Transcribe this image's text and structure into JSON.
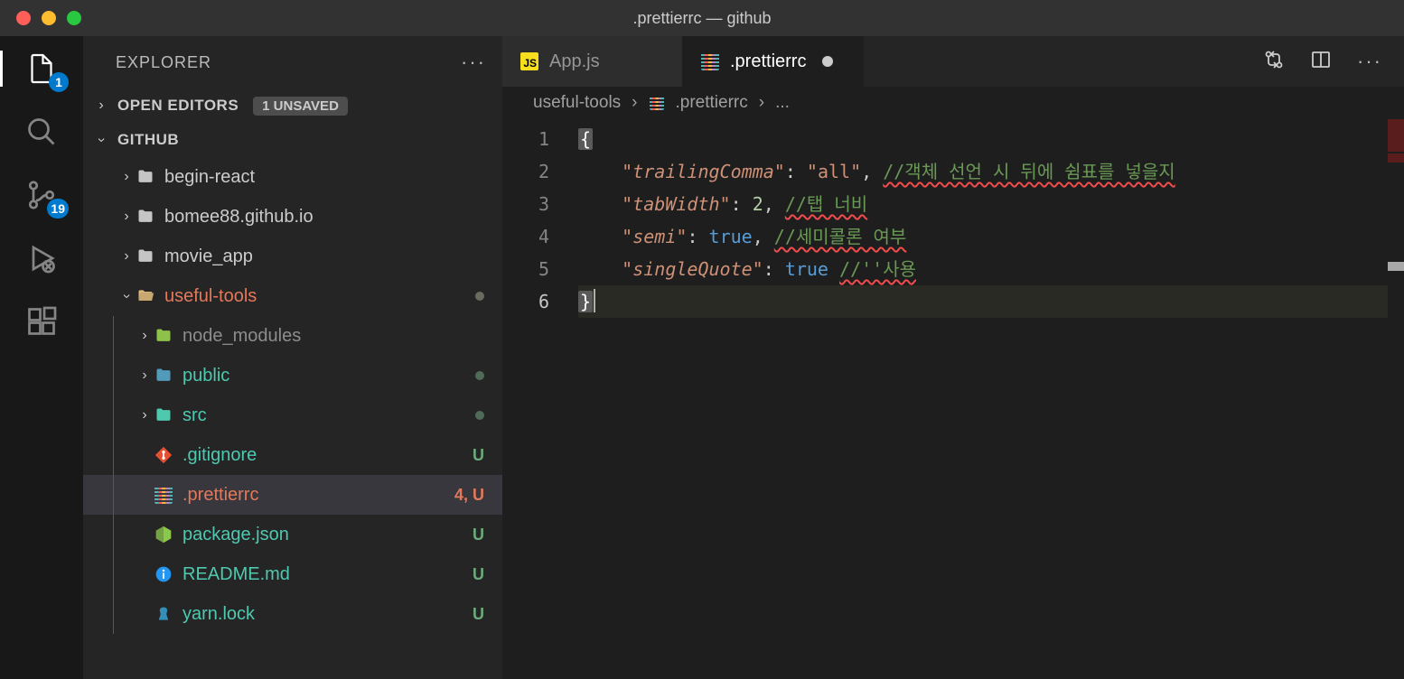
{
  "window": {
    "title": ".prettierrc — github"
  },
  "activity": {
    "explorer_badge": "1",
    "scm_badge": "19"
  },
  "sidebar": {
    "title": "EXPLORER",
    "open_editors_label": "OPEN EDITORS",
    "unsaved_label": "1 UNSAVED",
    "workspace_label": "GITHUB",
    "tree": {
      "begin_react": "begin-react",
      "bomee": "bomee88.github.io",
      "movie": "movie_app",
      "useful": "useful-tools",
      "node_modules": "node_modules",
      "public": "public",
      "src": "src",
      "gitignore": ".gitignore",
      "gitignore_status": "U",
      "prettierrc": ".prettierrc",
      "prettierrc_status": "4, U",
      "package": "package.json",
      "package_status": "U",
      "readme": "README.md",
      "readme_status": "U",
      "yarn": "yarn.lock",
      "yarn_status": "U"
    }
  },
  "tabs": {
    "app_js": "App.js",
    "prettierrc": ".prettierrc"
  },
  "breadcrumbs": {
    "folder": "useful-tools",
    "file": ".prettierrc",
    "rest": "..."
  },
  "editor": {
    "lines": [
      "1",
      "2",
      "3",
      "4",
      "5",
      "6"
    ],
    "l1_open": "{",
    "l2": {
      "q1": "\"",
      "k": "trailingComma",
      "q2": "\"",
      "colon": ": ",
      "qv1": "\"",
      "v": "all",
      "qv2": "\"",
      "comma": ", ",
      "c": "//객체 선언 시 뒤에 쉼표를 넣을지"
    },
    "l3": {
      "q1": "\"",
      "k": "tabWidth",
      "q2": "\"",
      "colon": ": ",
      "v": "2",
      "comma": ", ",
      "c": "//탭 너비"
    },
    "l4": {
      "q1": "\"",
      "k": "semi",
      "q2": "\"",
      "colon": ": ",
      "v": "true",
      "comma": ", ",
      "c": "//세미콜론 여부"
    },
    "l5": {
      "q1": "\"",
      "k": "singleQuote",
      "q2": "\"",
      "colon": ": ",
      "v": "true",
      "sp": " ",
      "c": "//''사용"
    },
    "l6_close": "}"
  }
}
